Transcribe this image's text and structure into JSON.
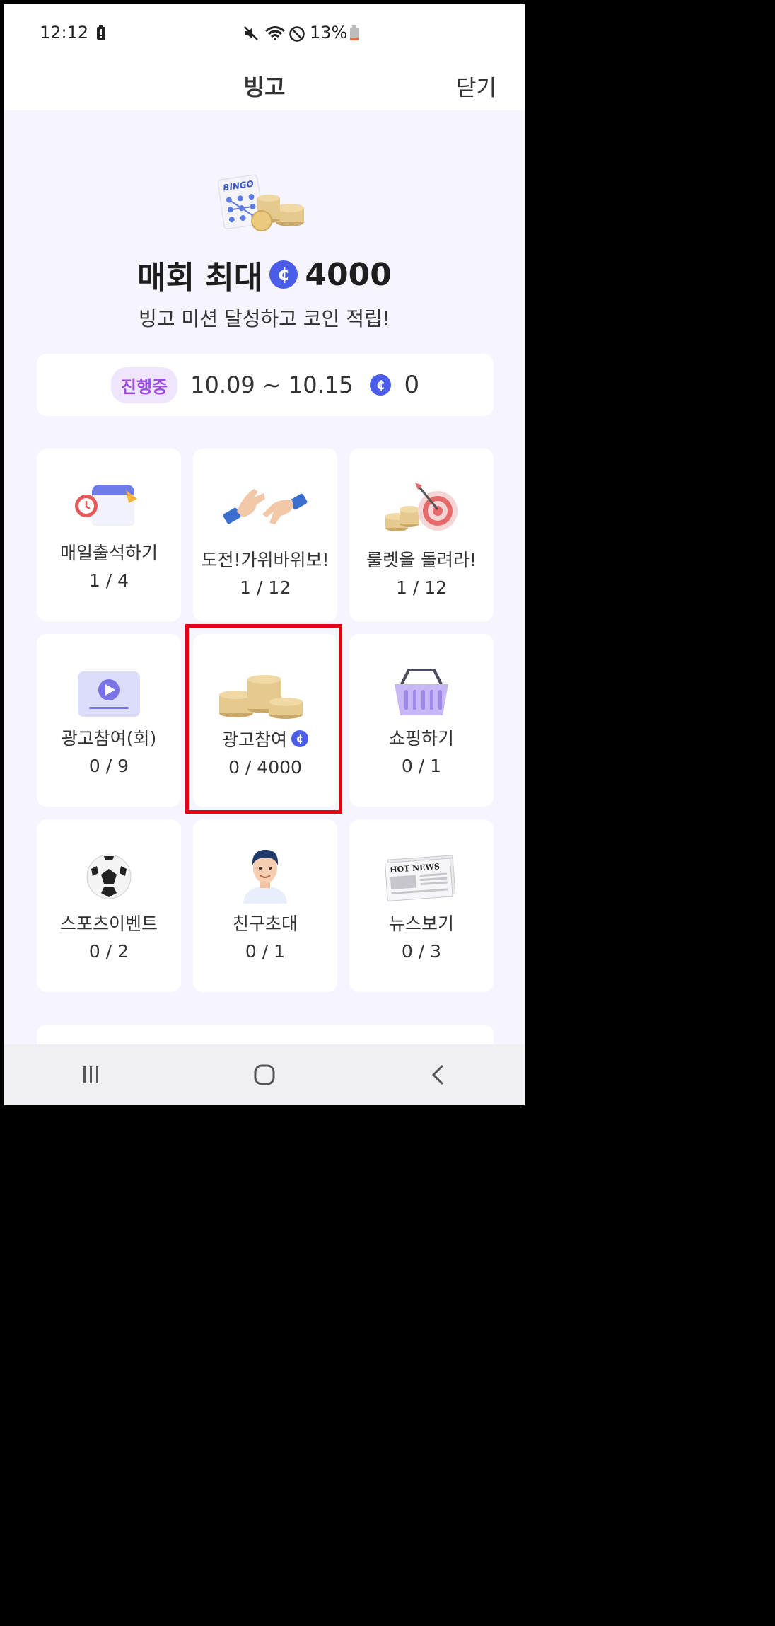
{
  "status_bar": {
    "time": "12:12",
    "battery_percent": "13%"
  },
  "header": {
    "title": "빙고",
    "close_label": "닫기"
  },
  "hero": {
    "title_prefix": "매회 최대",
    "coin_symbol": "¢",
    "max_reward": "4000",
    "subtitle": "빙고 미션 달성하고 코인 적립!"
  },
  "period": {
    "badge": "진행중",
    "dates": "10.09 ~ 10.15",
    "coins": "0"
  },
  "missions": [
    {
      "title": "매일출석하기",
      "count": "1 / 4",
      "icon": "calendar-alarm-icon"
    },
    {
      "title": "도전!가위바위보!",
      "count": "1 / 12",
      "icon": "hands-icon"
    },
    {
      "title": "룰렛을 돌려라!",
      "count": "1 / 12",
      "icon": "target-coins-icon"
    },
    {
      "title": "광고참여(회)",
      "count": "0 / 9",
      "icon": "video-play-icon"
    },
    {
      "title": "광고참여",
      "count": "0 / 4000",
      "icon": "coin-stacks-icon"
    },
    {
      "title": "쇼핑하기",
      "count": "0 / 1",
      "icon": "shopping-basket-icon"
    },
    {
      "title": "스포츠이벤트",
      "count": "0 / 2",
      "icon": "soccer-ball-icon"
    },
    {
      "title": "친구초대",
      "count": "0 / 1",
      "icon": "person-avatar-icon"
    },
    {
      "title": "뉴스보기",
      "count": "0 / 3",
      "icon": "newspaper-icon"
    }
  ],
  "newspaper_headline": "HOT NEWS",
  "bingo_card_label": "BINGO",
  "colors": {
    "coin": "#4a5ce8",
    "badge_text": "#9b4dde",
    "highlight": "#e60012",
    "background": "#f6f4fe"
  }
}
